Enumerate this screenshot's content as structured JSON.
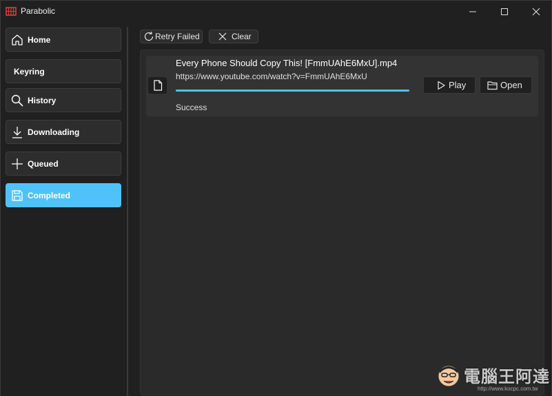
{
  "window": {
    "title": "Parabolic",
    "controls": [
      "minimize-icon",
      "maximize-icon",
      "close-icon"
    ]
  },
  "colors": {
    "accent": "#4fc3f7",
    "background": "#202020",
    "panel": "#2a2a2a",
    "row": "#333333",
    "app_icon": "#e53935"
  },
  "sidebar": {
    "items": [
      {
        "label": "Home",
        "icon": "home-icon"
      },
      {
        "label": "Keyring",
        "icon": ""
      },
      {
        "label": "History",
        "icon": "search-icon"
      },
      {
        "label": "Downloading",
        "icon": "download-icon"
      },
      {
        "label": "Queued",
        "icon": "plus-icon"
      },
      {
        "label": "Completed",
        "icon": "save-icon",
        "active": true
      }
    ]
  },
  "toolbar": {
    "retry_label": "Retry Failed",
    "clear_label": "Clear"
  },
  "downloads": [
    {
      "title": "Every Phone Should Copy This!  [FmmUAhE6MxU].mp4",
      "url": "https://www.youtube.com/watch?v=FmmUAhE6MxU",
      "progress": 1.0,
      "status": "Success",
      "play_label": "Play",
      "open_label": "Open"
    }
  ],
  "watermark": {
    "text": "電腦王阿達",
    "url": "http://www.kocpc.com.tw"
  }
}
